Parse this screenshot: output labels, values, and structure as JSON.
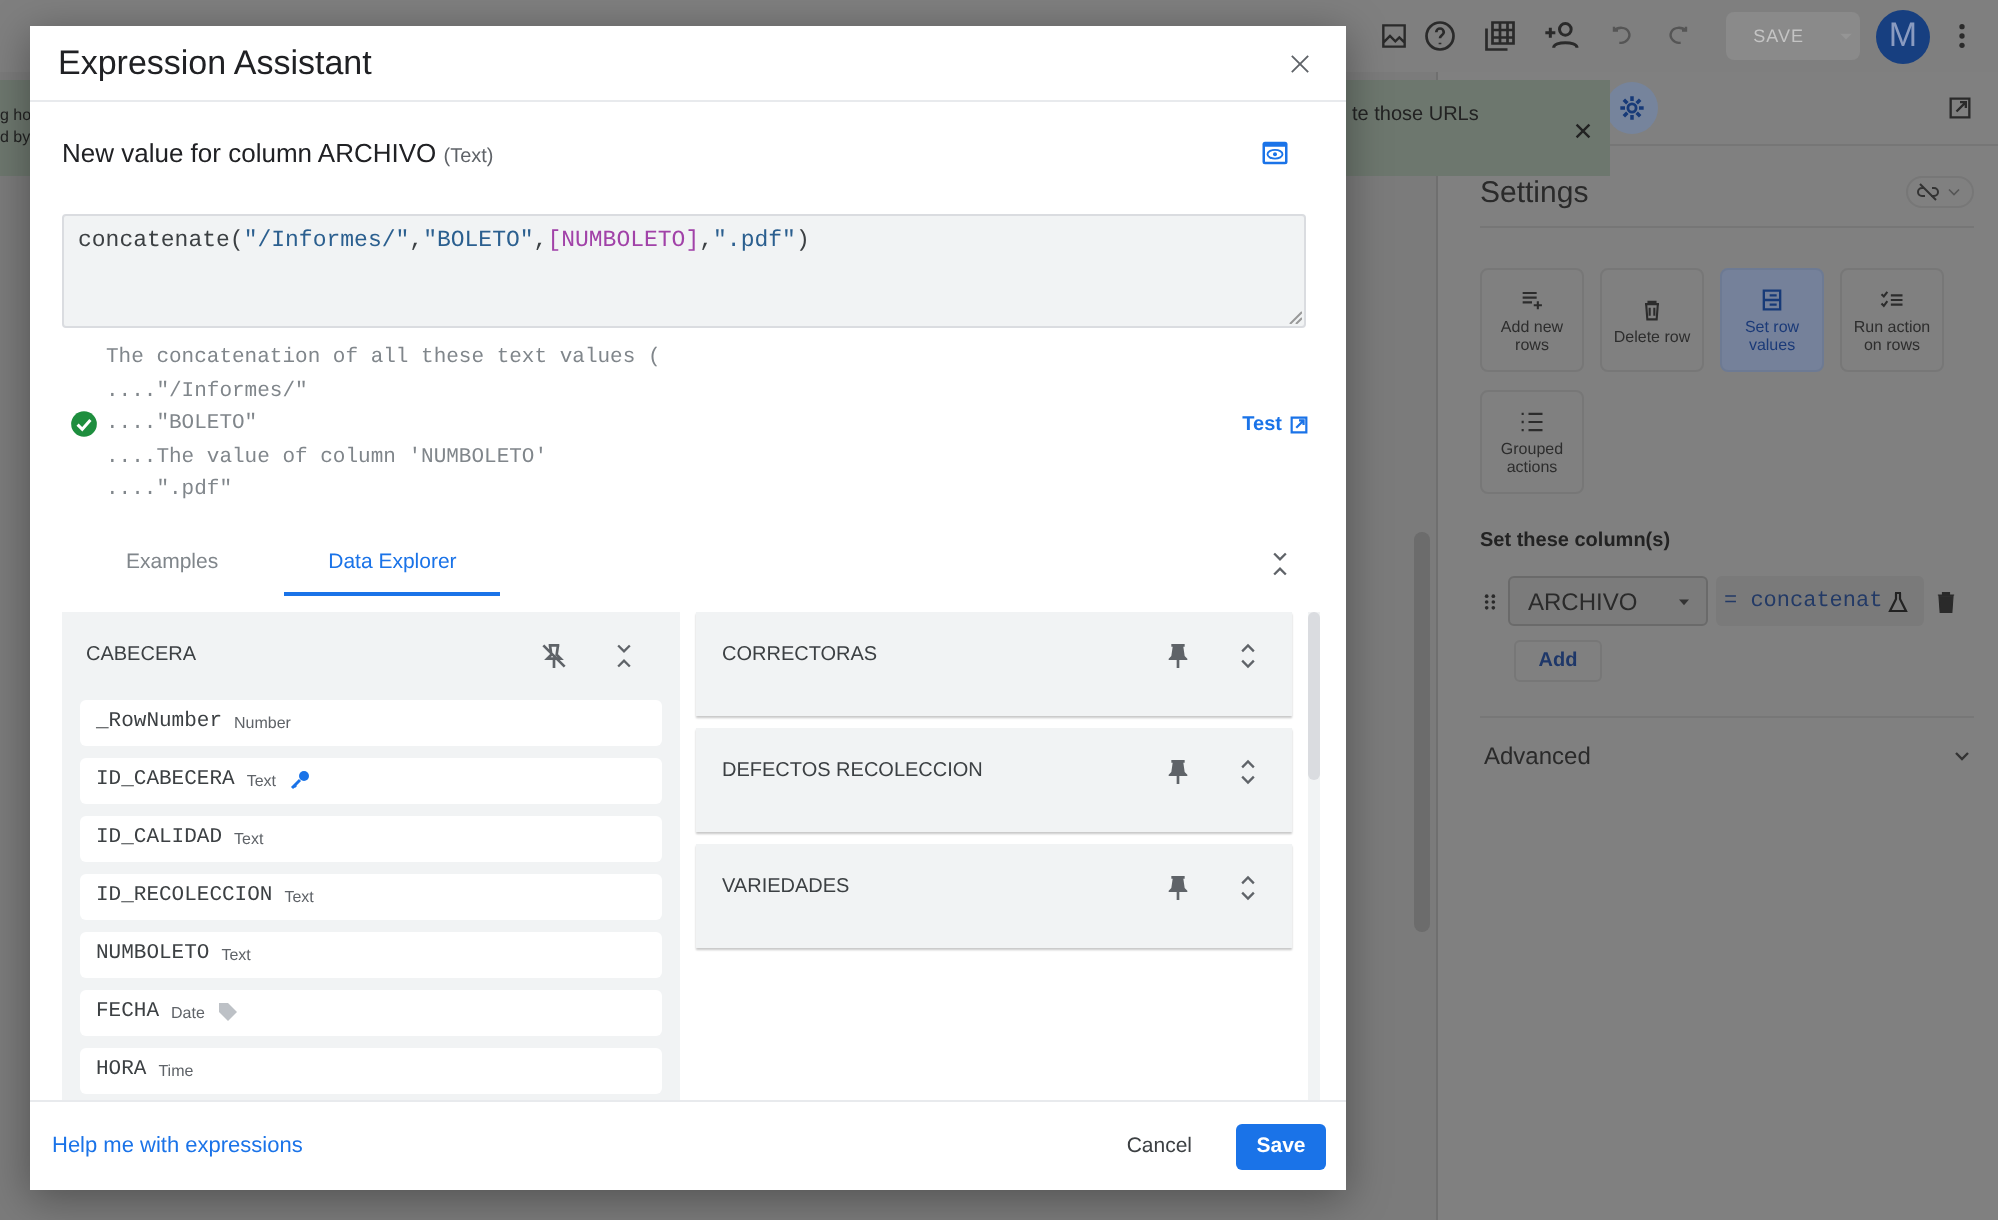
{
  "top_bar": {
    "save_label": "SAVE",
    "avatar_letter": "M"
  },
  "banner": {
    "fragments_left": [
      "g ho",
      "d by"
    ],
    "text_right": "te those URLs"
  },
  "settings_panel": {
    "title": "Settings",
    "actions": [
      {
        "kind": "add",
        "label": "Add new rows",
        "selected": false
      },
      {
        "kind": "delete",
        "label": "Delete row",
        "selected": false
      },
      {
        "kind": "set",
        "label": "Set row values",
        "selected": true
      },
      {
        "kind": "run",
        "label": "Run action on rows",
        "selected": false
      },
      {
        "kind": "group",
        "label": "Grouped actions",
        "selected": false
      }
    ],
    "set_columns_label": "Set these column(s)",
    "column_select": "ARCHIVO",
    "formula": "= concatenat",
    "add_button": "Add",
    "advanced": "Advanced"
  },
  "dialog": {
    "title": "Expression Assistant",
    "heading": "New value for column ARCHIVO",
    "heading_type": "(Text)",
    "expression": [
      {
        "text": "concatenate",
        "kind": "func"
      },
      {
        "text": "(",
        "kind": "punct"
      },
      {
        "text": "\"/Informes/\"",
        "kind": "string"
      },
      {
        "text": ",",
        "kind": "punct"
      },
      {
        "text": "\"BOLETO\"",
        "kind": "string"
      },
      {
        "text": ",",
        "kind": "punct"
      },
      {
        "text": "[NUMBOLETO]",
        "kind": "column"
      },
      {
        "text": ",",
        "kind": "punct"
      },
      {
        "text": "\".pdf\"",
        "kind": "string"
      },
      {
        "text": ")",
        "kind": "punct"
      }
    ],
    "result_valid": true,
    "result_lines": [
      "The concatenation of all these text values (",
      "....\"/Informes/\"",
      "....\"BOLETO\"",
      "....The value of column 'NUMBOLETO'",
      "....\".pdf\""
    ],
    "test_link": "Test",
    "tabs": [
      {
        "label": "Examples",
        "selected": false
      },
      {
        "label": "Data Explorer",
        "selected": true
      }
    ],
    "tables": [
      {
        "name": "CABECERA",
        "pinned": true,
        "expanded": true,
        "columns": [
          {
            "name": "_RowNumber",
            "type": "Number",
            "kind": "plain"
          },
          {
            "name": "ID_CABECERA",
            "type": "Text",
            "kind": "key"
          },
          {
            "name": "ID_CALIDAD",
            "type": "Text",
            "kind": "plain"
          },
          {
            "name": "ID_RECOLECCION",
            "type": "Text",
            "kind": "plain"
          },
          {
            "name": "NUMBOLETO",
            "type": "Text",
            "kind": "plain"
          },
          {
            "name": "FECHA",
            "type": "Date",
            "kind": "tag"
          },
          {
            "name": "HORA",
            "type": "Time",
            "kind": "plain"
          }
        ]
      },
      {
        "name": "CORRECTORAS",
        "pinned": false,
        "expanded": false
      },
      {
        "name": "DEFECTOS RECOLECCION",
        "pinned": false,
        "expanded": false
      },
      {
        "name": "VARIEDADES",
        "pinned": false,
        "expanded": false
      }
    ],
    "help_link": "Help me with expressions",
    "cancel": "Cancel",
    "save": "Save"
  }
}
